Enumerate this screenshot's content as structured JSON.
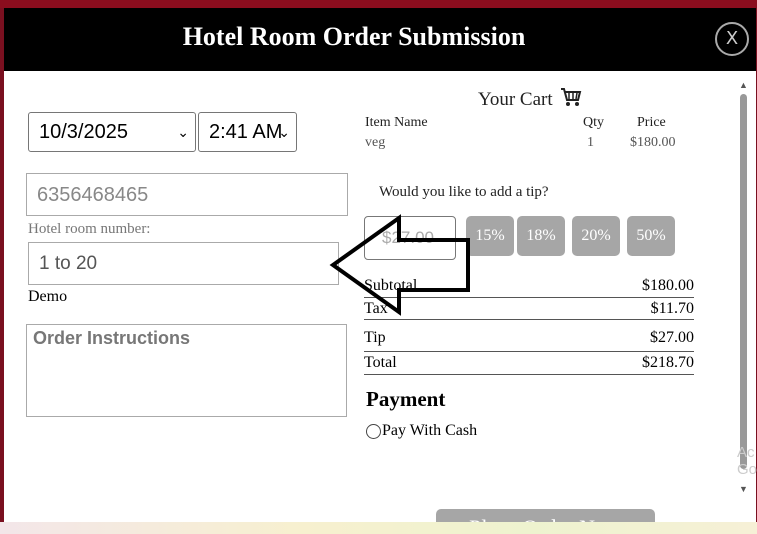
{
  "modal": {
    "title": "Hotel Room Order Submission",
    "close_label": "X"
  },
  "form": {
    "date_value": "10/3/2025",
    "time_value": "2:41 AM",
    "phone_value": "6356468465",
    "room_label": "Hotel room number:",
    "room_placeholder": "1 to 20",
    "demo_text": "Demo",
    "instructions_placeholder": "Order Instructions"
  },
  "cart": {
    "title": "Your Cart",
    "columns": [
      "Item Name",
      "Qty",
      "Price"
    ],
    "items": [
      {
        "name": "veg",
        "qty": "1",
        "price": "$180.00"
      }
    ]
  },
  "tip": {
    "question": "Would you like to add a tip?",
    "input_value": "$27.00",
    "options": [
      "15%",
      "18%",
      "20%",
      "50%"
    ]
  },
  "summary": {
    "subtotal_label": "Subtotal",
    "subtotal": "$180.00",
    "tax_label": "Tax",
    "tax": "$11.70",
    "tip_label": "Tip",
    "tip": "$27.00",
    "total_label": "Total",
    "total": "$218.70"
  },
  "payment": {
    "title": "Payment",
    "cash_label": "Pay With Cash"
  },
  "place_order_label": "Place Order Now",
  "background_text": "Ac Go",
  "colors": {
    "header_bg": "#000000",
    "tip_button": "#a6a6a6",
    "page_bg": "#8b0d1e"
  }
}
